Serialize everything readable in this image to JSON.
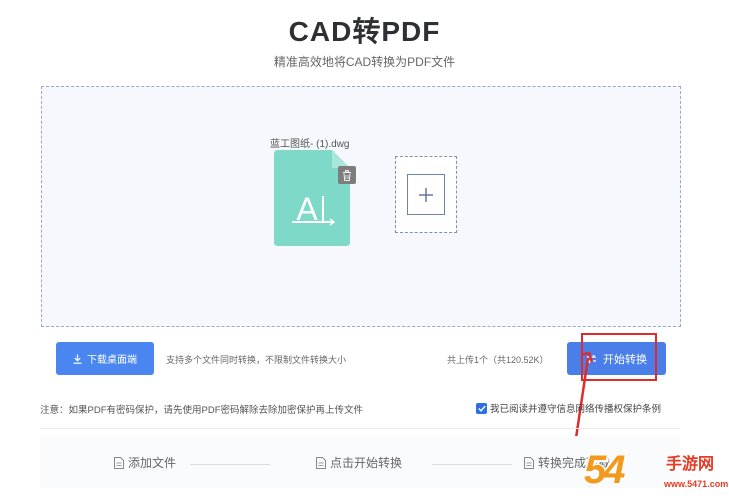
{
  "header": {
    "title": "CAD转PDF",
    "subtitle": "精准高效地将CAD转换为PDF文件"
  },
  "upload": {
    "file_name": "蓝工图纸- (1).dwg",
    "file_icon": "autocad-file-icon",
    "delete_icon": "trash-icon",
    "add_icon": "plus-icon"
  },
  "toolbar": {
    "download_label": "下载桌面端",
    "hint": "支持多个文件同时转换，不限制文件转换大小",
    "counter": "共上传1个（共120.52K）",
    "start_label": "开始转换"
  },
  "notice": {
    "text": "注意：如果PDF有密码保护，请先使用PDF密码解除去除加密保护再上传文件",
    "agree_label": "我已阅读并遵守信息网络传播权保护条例",
    "agree_checked": true
  },
  "steps": [
    {
      "label": "添加文件"
    },
    {
      "label": "点击开始转换"
    },
    {
      "label": "转换完成下载"
    }
  ],
  "watermark": {
    "digits": "54",
    "text": "手游网",
    "url": "www.5471.com"
  },
  "colors": {
    "primary": "#4a86f0",
    "file_icon_bg": "#7ed9c8",
    "highlight": "#e02b2b",
    "watermark_orange": "#f39a1e",
    "watermark_red": "#e53a23"
  }
}
